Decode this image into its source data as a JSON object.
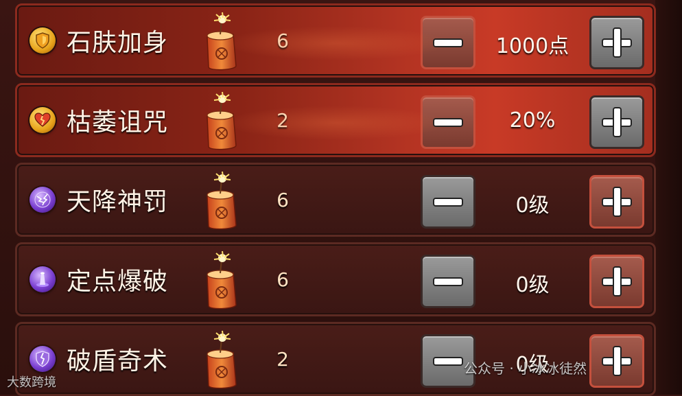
{
  "skills": [
    {
      "name": "石肤加身",
      "icon": "shield-icon",
      "icon_color": "gold",
      "count": "6",
      "value": "1000点",
      "active": true,
      "minus_style": "red",
      "plus_style": "grey"
    },
    {
      "name": "枯萎诅咒",
      "icon": "broken-heart-icon",
      "icon_color": "gold",
      "count": "2",
      "value": "20%",
      "active": true,
      "minus_style": "red",
      "plus_style": "grey"
    },
    {
      "name": "天降神罚",
      "icon": "lightning-orb-icon",
      "icon_color": "purple",
      "count": "6",
      "value": "0级",
      "active": false,
      "minus_style": "grey",
      "plus_style": "red"
    },
    {
      "name": "定点爆破",
      "icon": "pillar-blast-icon",
      "icon_color": "purple",
      "count": "6",
      "value": "0级",
      "active": false,
      "minus_style": "grey",
      "plus_style": "red"
    },
    {
      "name": "破盾奇术",
      "icon": "broken-shield-icon",
      "icon_color": "purple",
      "count": "2",
      "value": "0级",
      "active": false,
      "minus_style": "grey",
      "plus_style": "red"
    }
  ],
  "watermark_left": "大数跨境",
  "watermark_right": "公众号 · 小冰冰徒然"
}
